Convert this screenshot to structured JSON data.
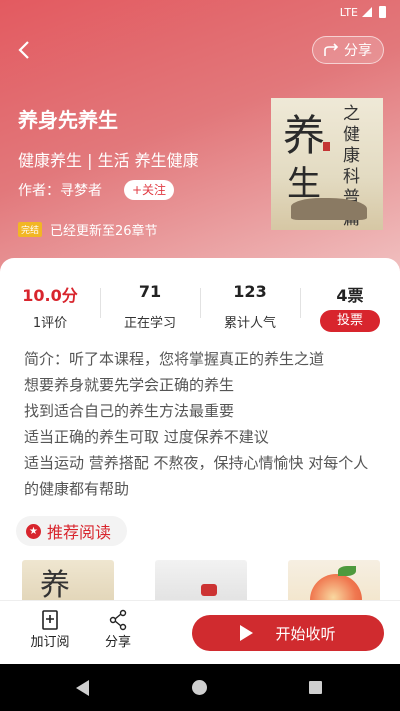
{
  "status_bar": {
    "network": "LTE"
  },
  "header": {
    "share_label": "分享"
  },
  "book": {
    "title": "养身先养生",
    "tags": "健康养生 | 生活 养生健康",
    "author": "作者：寻梦者",
    "follow_label": "+关注",
    "status_badge": "完结",
    "update_text": "已经更新至26章节",
    "cover_text": {
      "main_1": "养",
      "main_2": "生",
      "side": "之健康科普篇"
    }
  },
  "stats": [
    {
      "value": "10.0分",
      "label": "1评价"
    },
    {
      "value": "71",
      "label": "正在学习"
    },
    {
      "value": "123",
      "label": "累计人气"
    },
    {
      "value": "4票",
      "label": "投票"
    }
  ],
  "intro_lines": [
    "简介：听了本课程，您将掌握真正的养生之道",
    "想要养身就要先学会正确的养生",
    "找到适合自己的养生方法最重要",
    "适当正确的养生可取  过度保养不建议",
    "适当运动 营养搭配  不熬夜，保持心情愉快 对每个人",
    "的健康都有帮助"
  ],
  "recommend": {
    "title": "推荐阅读"
  },
  "bottom_bar": {
    "subscribe_label": "加订阅",
    "share_label": "分享",
    "start_label": "开始收听"
  },
  "colors": {
    "accent": "#d8252d",
    "hero_start": "#e35a60",
    "hero_end": "#f1c2c2"
  }
}
